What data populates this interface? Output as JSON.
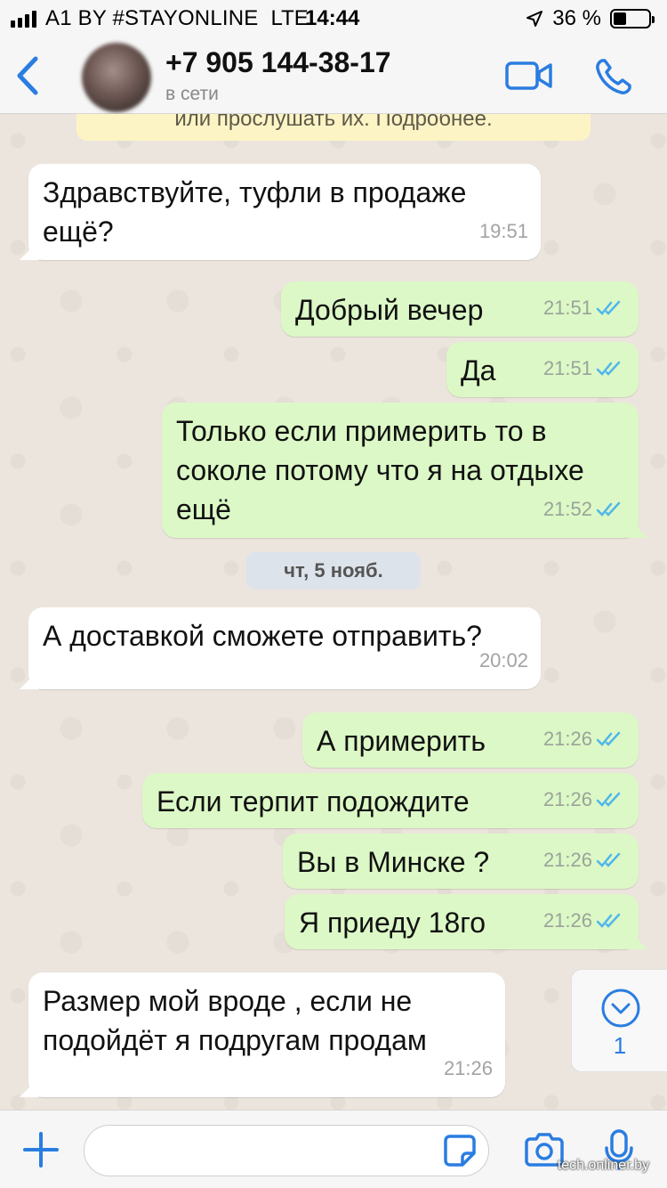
{
  "status_bar": {
    "carrier": "A1 BY #STAYONLINE",
    "network": "LTE",
    "time": "14:44",
    "battery": "36 %",
    "battery_level": 0.36
  },
  "header": {
    "back_icon": "chevron-left-icon",
    "contact_name": "+7 905 144-38-17",
    "contact_status": "в сети",
    "video_icon": "video-call-icon",
    "call_icon": "phone-icon",
    "accent": "#2a7de1"
  },
  "notice": {
    "text": "или прослушать их. Подробнее."
  },
  "messages": [
    {
      "direction": "in",
      "lines": [
        "Здравствуйте, туфли в продаже",
        "ещё?"
      ],
      "time": "19:51"
    },
    {
      "direction": "out",
      "lines": [
        "Добрый вечер"
      ],
      "time": "21:51",
      "status": "read"
    },
    {
      "direction": "out",
      "lines": [
        "Да"
      ],
      "time": "21:51",
      "status": "read"
    },
    {
      "direction": "out",
      "lines": [
        "Только если примерить то в",
        "соколе потому что я на отдыхе",
        "ещё"
      ],
      "time": "21:52",
      "status": "read"
    },
    {
      "direction": "in",
      "lines": [
        "А доставкой сможете отправить?"
      ],
      "time": "20:02"
    },
    {
      "direction": "out",
      "lines": [
        "А примерить"
      ],
      "time": "21:26",
      "status": "read"
    },
    {
      "direction": "out",
      "lines": [
        "Если терпит подождите"
      ],
      "time": "21:26",
      "status": "read"
    },
    {
      "direction": "out",
      "lines": [
        "Вы в Минске ?"
      ],
      "time": "21:26",
      "status": "read"
    },
    {
      "direction": "out",
      "lines": [
        "Я приеду 18го"
      ],
      "time": "21:26",
      "status": "read"
    },
    {
      "direction": "in",
      "lines": [
        "Размер мой вроде , если не",
        "подойдёт я подругам продам"
      ],
      "time": "21:26"
    }
  ],
  "date_separator": "чт, 5 нояб.",
  "scroll_button": {
    "icon": "chevron-down-circle-icon",
    "unread_count": "1"
  },
  "input_bar": {
    "attach_icon": "plus-icon",
    "text_value": "",
    "sticker_icon": "sticker-icon",
    "camera_icon": "camera-icon",
    "mic_icon": "microphone-icon"
  },
  "watermark": "tech.onliner.by",
  "colors": {
    "outgoing_bubble": "#dcf8c6",
    "incoming_bubble": "#ffffff",
    "read_ticks": "#4fb6ec",
    "notice_bg": "#fdf4c5"
  }
}
